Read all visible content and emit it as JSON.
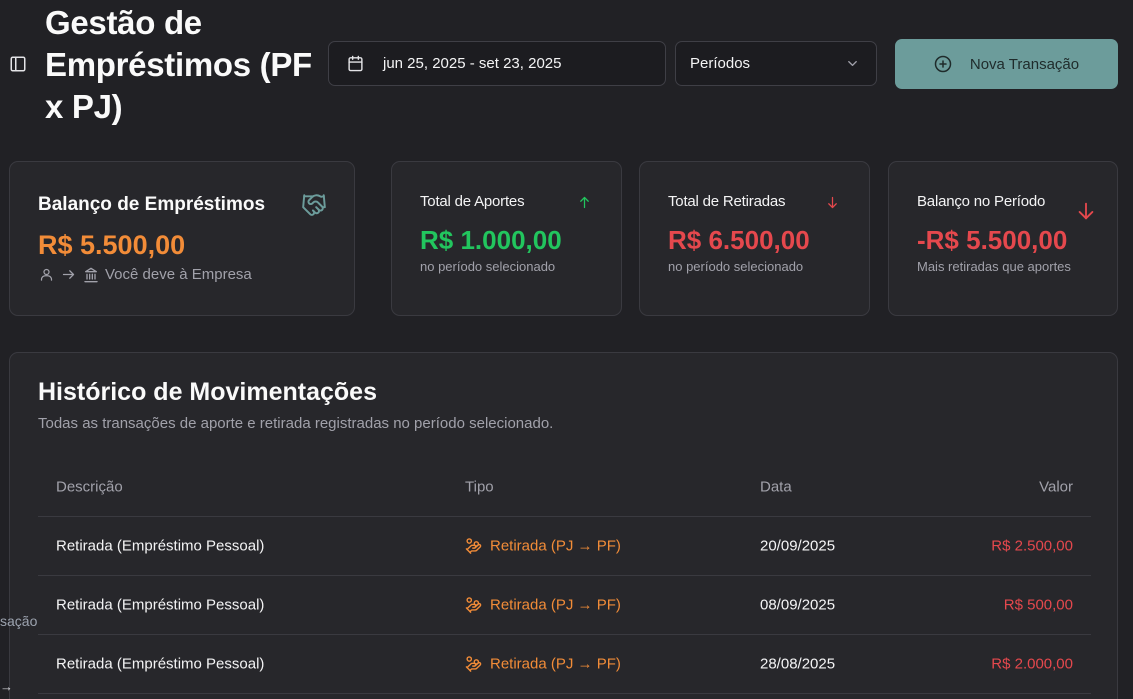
{
  "header": {
    "title": "Gestão de Empréstimos (PF x PJ)",
    "date_range": "jun 25, 2025 - set 23, 2025",
    "period_select": "Períodos",
    "new_transaction_label": "Nova Transação"
  },
  "cards": {
    "loan_balance": {
      "title": "Balanço de Empréstimos",
      "value": "R$ 5.500,00",
      "direction_text": "Você deve à Empresa",
      "value_color": "#f28c38"
    },
    "total_contributions": {
      "title": "Total de Aportes",
      "value": "R$ 1.000,00",
      "subtitle": "no período selecionado",
      "value_color": "#22c55e"
    },
    "total_withdrawals": {
      "title": "Total de Retiradas",
      "value": "R$ 6.500,00",
      "subtitle": "no período selecionado",
      "value_color": "#e5484d"
    },
    "period_balance": {
      "title": "Balanço no Período",
      "value": "-R$ 5.500,00",
      "subtitle": "Mais retiradas que aportes",
      "value_color": "#e5484d"
    }
  },
  "history": {
    "title": "Histórico de Movimentações",
    "subtitle": "Todas as transações de aporte e retirada registradas no período selecionado.",
    "columns": {
      "description": "Descrição",
      "type": "Tipo",
      "date": "Data",
      "value": "Valor"
    },
    "rows": [
      {
        "description": "Retirada (Empréstimo Pessoal)",
        "type": "Retirada (PJ → PF)",
        "date": "20/09/2025",
        "value": "R$ 2.500,00"
      },
      {
        "description": "Retirada (Empréstimo Pessoal)",
        "type": "Retirada (PJ → PF)",
        "date": "08/09/2025",
        "value": "R$ 500,00"
      },
      {
        "description": "Retirada (Empréstimo Pessoal)",
        "type": "Retirada (PJ → PF)",
        "date": "28/08/2025",
        "value": "R$ 2.000,00"
      }
    ]
  },
  "overlay": {
    "tooltip_fragment": "sação",
    "edge_arrow": "→"
  },
  "icons": {
    "sidebar_toggle": "panel-left-icon",
    "calendar": "calendar-icon",
    "chevron": "chevron-down-icon",
    "plus_circle": "plus-circle-icon",
    "handshake": "handshake-icon",
    "arrow_up": "arrow-up-icon",
    "arrow_down": "arrow-down-icon",
    "user": "user-icon",
    "bank": "landmark-icon",
    "hand_coins": "hand-coins-icon"
  }
}
